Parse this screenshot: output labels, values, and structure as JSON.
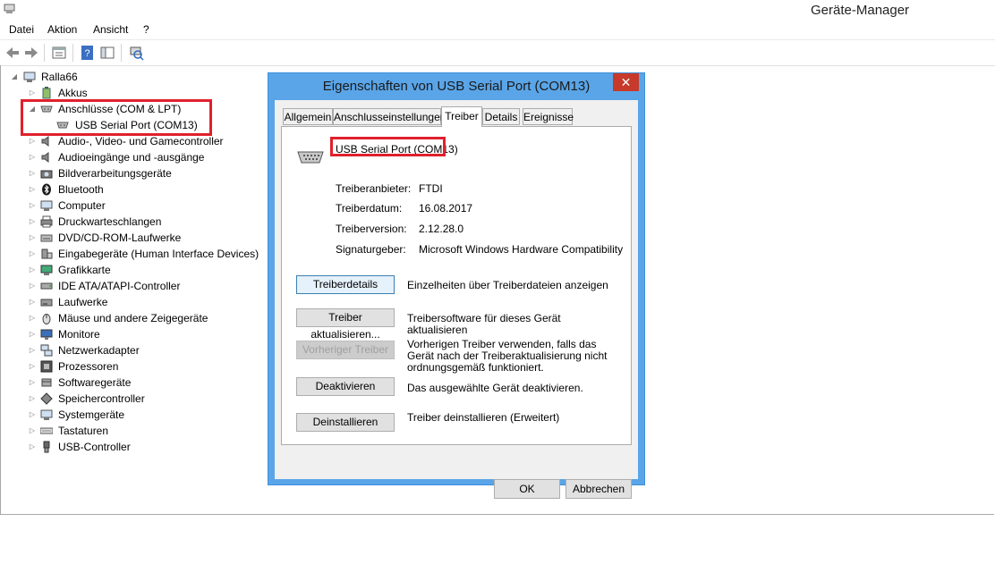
{
  "window": {
    "title": "Geräte-Manager"
  },
  "menu": [
    "Datei",
    "Aktion",
    "Ansicht",
    "?"
  ],
  "toolbar": {
    "buttons": [
      "back-icon",
      "forward-icon",
      "properties-icon",
      "help-icon",
      "show-hide-icon",
      "scan-hardware-icon"
    ]
  },
  "tree": {
    "root": "Ralla66",
    "items": [
      {
        "label": "Akkus",
        "icon": "battery-icon",
        "expanded": false
      },
      {
        "label": "Anschlüsse (COM & LPT)",
        "icon": "port-icon",
        "expanded": true
      },
      {
        "label": "USB Serial Port (COM13)",
        "icon": "port-icon",
        "child": true
      },
      {
        "label": "Audio-, Video- und Gamecontroller",
        "icon": "speaker-icon",
        "expanded": false
      },
      {
        "label": "Audioeingänge und -ausgänge",
        "icon": "speaker-icon",
        "expanded": false
      },
      {
        "label": "Bildverarbeitungsgeräte",
        "icon": "camera-icon",
        "expanded": false
      },
      {
        "label": "Bluetooth",
        "icon": "bluetooth-icon",
        "expanded": false
      },
      {
        "label": "Computer",
        "icon": "computer-icon",
        "expanded": false
      },
      {
        "label": "Druckwarteschlangen",
        "icon": "printer-icon",
        "expanded": false
      },
      {
        "label": "DVD/CD-ROM-Laufwerke",
        "icon": "disc-drive-icon",
        "expanded": false
      },
      {
        "label": "Eingabegeräte (Human Interface Devices)",
        "icon": "hid-icon",
        "expanded": false
      },
      {
        "label": "Grafikkarte",
        "icon": "display-adapter-icon",
        "expanded": false
      },
      {
        "label": "IDE ATA/ATAPI-Controller",
        "icon": "ide-controller-icon",
        "expanded": false
      },
      {
        "label": "Laufwerke",
        "icon": "disk-drive-icon",
        "expanded": false
      },
      {
        "label": "Mäuse und andere Zeigegeräte",
        "icon": "mouse-icon",
        "expanded": false
      },
      {
        "label": "Monitore",
        "icon": "monitor-icon",
        "expanded": false
      },
      {
        "label": "Netzwerkadapter",
        "icon": "network-adapter-icon",
        "expanded": false
      },
      {
        "label": "Prozessoren",
        "icon": "processor-icon",
        "expanded": false
      },
      {
        "label": "Softwaregeräte",
        "icon": "software-device-icon",
        "expanded": false
      },
      {
        "label": "Speichercontroller",
        "icon": "storage-controller-icon",
        "expanded": false
      },
      {
        "label": "Systemgeräte",
        "icon": "system-device-icon",
        "expanded": false
      },
      {
        "label": "Tastaturen",
        "icon": "keyboard-icon",
        "expanded": false
      },
      {
        "label": "USB-Controller",
        "icon": "usb-icon",
        "expanded": false
      }
    ]
  },
  "dialog": {
    "title": "Eigenschaften von USB Serial Port (COM13)",
    "close_label": "✕",
    "tabs": [
      "Allgemein",
      "Anschlusseinstellungen",
      "Treiber",
      "Details",
      "Ereignisse"
    ],
    "active_tab": "Treiber",
    "device_name": "USB Serial Port (COM13)",
    "info": [
      {
        "label": "Treiberanbieter:",
        "value": "FTDI"
      },
      {
        "label": "Treiberdatum:",
        "value": "16.08.2017"
      },
      {
        "label": "Treiberversion:",
        "value": "2.12.28.0"
      },
      {
        "label": "Signaturgeber:",
        "value": "Microsoft Windows Hardware Compatibility"
      }
    ],
    "actions": [
      {
        "button": "Treiberdetails",
        "description": "Einzelheiten über Treiberdateien anzeigen",
        "enabled": true
      },
      {
        "button": "Treiber aktualisieren...",
        "description": "Treibersoftware für dieses Gerät aktualisieren",
        "enabled": true
      },
      {
        "button": "Vorheriger Treiber",
        "description": "Vorherigen Treiber verwenden, falls das Gerät nach der Treiberaktualisierung nicht ordnungsgemäß funktioniert.",
        "enabled": false
      },
      {
        "button": "Deaktivieren",
        "description": "Das ausgewählte Gerät deaktivieren.",
        "enabled": true
      },
      {
        "button": "Deinstallieren",
        "description": "Treiber deinstallieren (Erweitert)",
        "enabled": true
      }
    ],
    "ok_label": "OK",
    "cancel_label": "Abbrechen"
  },
  "colors": {
    "highlight_box": "#e0202c",
    "dialog_frame": "#5aa5e8",
    "close_button": "#c7392a"
  }
}
